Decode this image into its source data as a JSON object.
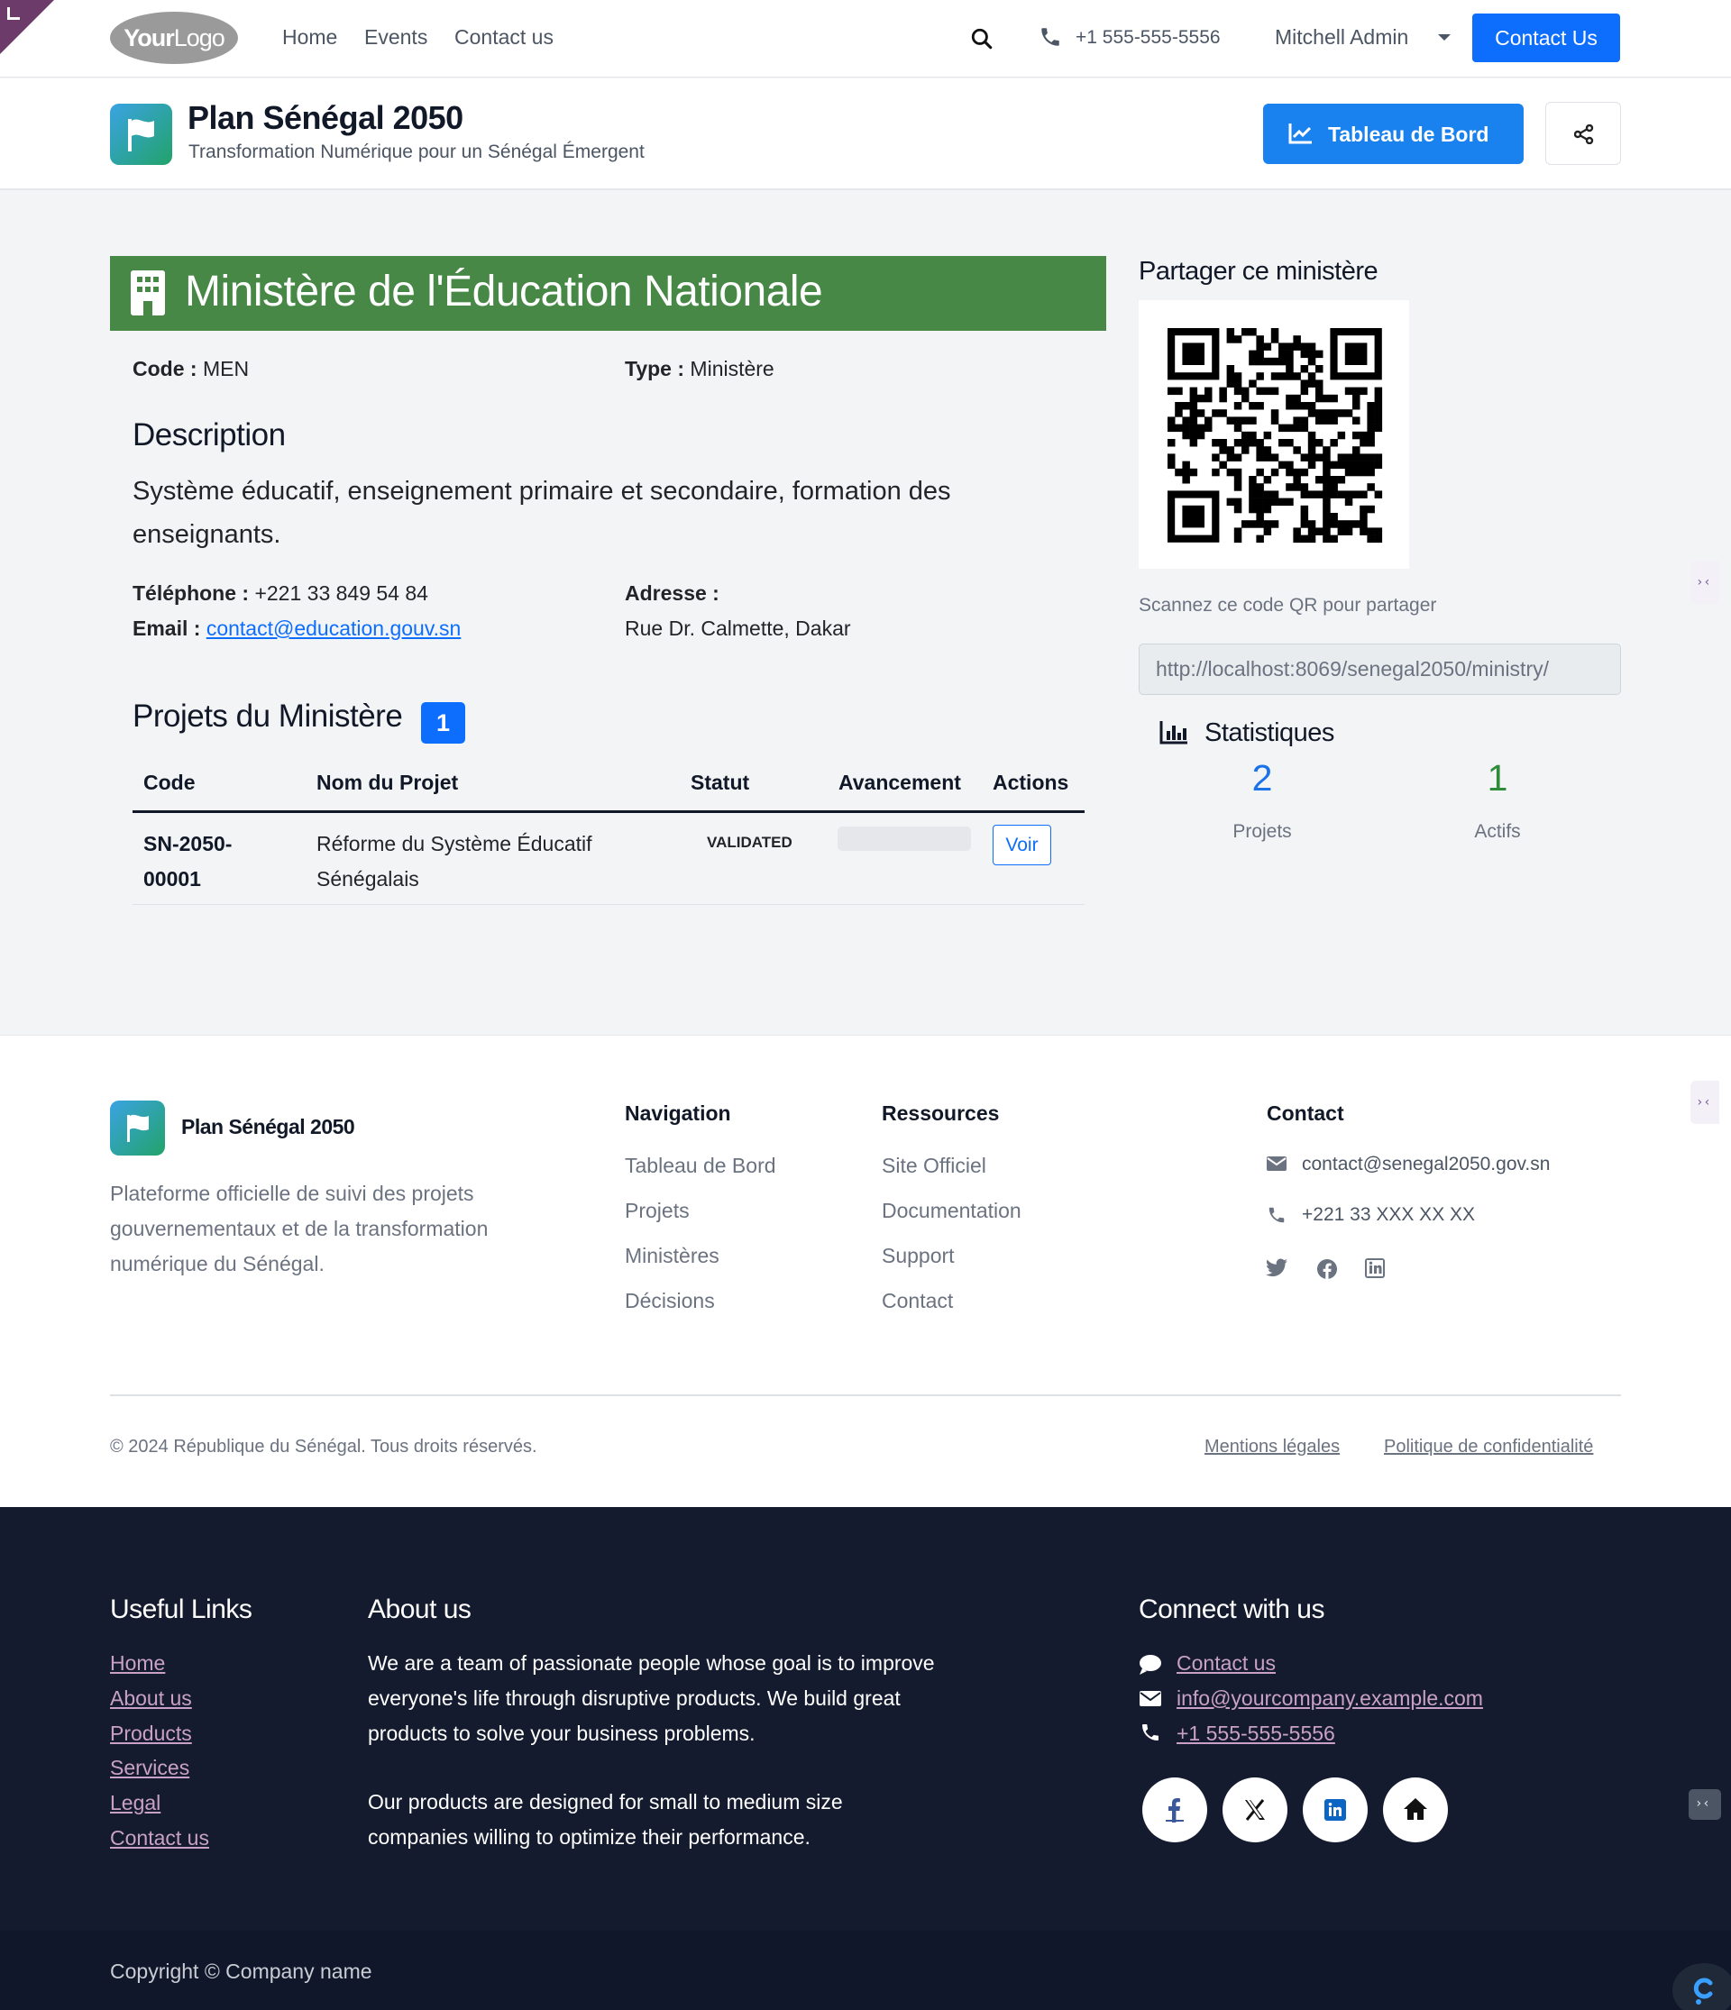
{
  "topnav": {
    "menu": [
      "Home",
      "Events",
      "Contact us"
    ],
    "phone": "+1 555-555-5556",
    "user": "Mitchell Admin",
    "contact_button": "Contact Us",
    "logo": {
      "bold": "Your",
      "rest": "Logo"
    }
  },
  "header": {
    "title": "Plan Sénégal 2050",
    "subtitle": "Transformation Numérique pour un Sénégal Émergent",
    "dashboard_button": "Tableau de Bord"
  },
  "ministry": {
    "title": "Ministère de l'Éducation Nationale",
    "code_label": "Code :",
    "code": "MEN",
    "type_label": "Type :",
    "type": "Ministère",
    "description_heading": "Description",
    "description": "Système éducatif, enseignement primaire et secondaire, formation des enseignants.",
    "phone_label": "Téléphone :",
    "phone": "+221 33 849 54 84",
    "email_label": "Email :",
    "email": "contact@education.gouv.sn",
    "address_label": "Adresse :",
    "address": "Rue Dr. Calmette, Dakar",
    "banner_color": "#478846"
  },
  "projects": {
    "heading": "Projets du Ministère",
    "count": "1",
    "columns": [
      "Code",
      "Nom du Projet",
      "Statut",
      "Avancement",
      "Actions"
    ],
    "rows": [
      {
        "code": "SN-2050-00001",
        "name": "Réforme du Système Éducatif Sénégalais",
        "status": "VALIDATED",
        "progress": 0,
        "action": "Voir"
      }
    ]
  },
  "sidebar": {
    "share_heading": "Partager ce ministère",
    "qr_caption": "Scannez ce code QR pour partager",
    "share_url": "http://localhost:8069/senegal2050/ministry/",
    "stats_heading": "Statistiques",
    "stats": [
      {
        "value": "2",
        "label": "Projets",
        "color": "#1a73e8"
      },
      {
        "value": "1",
        "label": "Actifs",
        "color": "#2e8b3a"
      }
    ]
  },
  "footer": {
    "brand": "Plan Sénégal 2050",
    "description": "Plateforme officielle de suivi des projets gouvernementaux et de la transformation numérique du Sénégal.",
    "navigation_heading": "Navigation",
    "navigation": [
      "Tableau de Bord",
      "Projets",
      "Ministères",
      "Décisions"
    ],
    "resources_heading": "Ressources",
    "resources": [
      "Site Officiel",
      "Documentation",
      "Support",
      "Contact"
    ],
    "contact_heading": "Contact",
    "contact_email": "contact@senegal2050.gov.sn",
    "contact_phone": "+221 33 XXX XX XX",
    "copyright": "© 2024 République du Sénégal. Tous droits réservés.",
    "legal": "Mentions légales",
    "privacy": "Politique de confidentialité"
  },
  "site_footer": {
    "useful_links_heading": "Useful Links",
    "useful_links": [
      "Home",
      "About us",
      "Products",
      "Services",
      "Legal",
      "Contact us"
    ],
    "about_heading": "About us",
    "about_p1": "We are a team of passionate people whose goal is to improve everyone's life through disruptive products. We build great products to solve your business problems.",
    "about_p2": "Our products are designed for small to medium size companies willing to optimize their performance.",
    "connect_heading": "Connect with us",
    "connect_links": [
      "Contact us",
      "info@yourcompany.example.com",
      "+1 555-555-5556"
    ],
    "copyright": "Copyright © Company name"
  }
}
